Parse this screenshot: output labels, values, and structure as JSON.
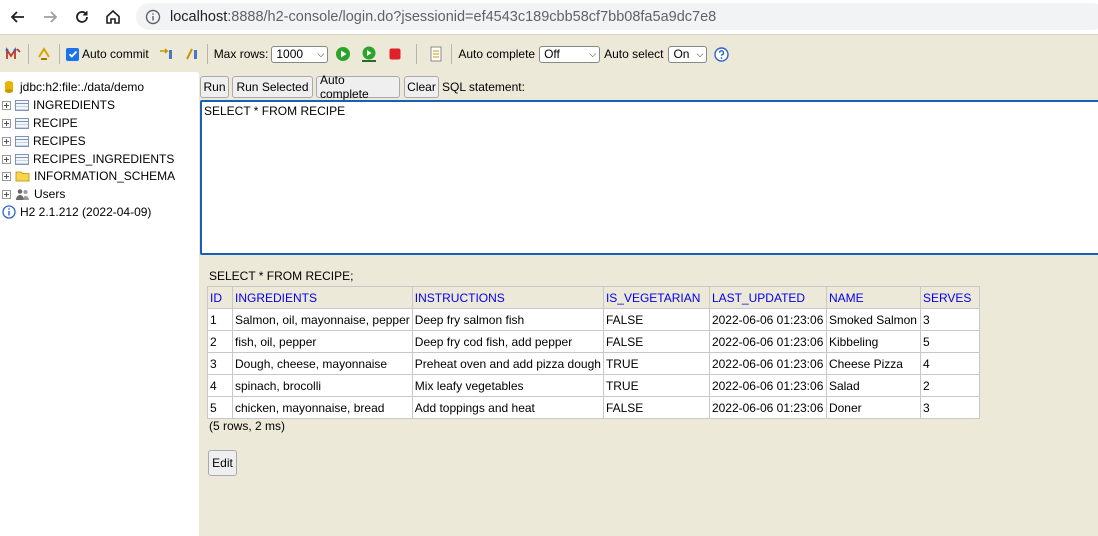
{
  "browser": {
    "url_host": "localhost",
    "url_path": ":8888/h2-console/login.do?jsessionid=ef4543c189cbb58cf7bb08fa5a9dc7e8"
  },
  "toolbar": {
    "auto_commit_label": "Auto commit",
    "max_rows_label": "Max rows:",
    "max_rows_value": "1000",
    "auto_complete_label": "Auto complete",
    "auto_complete_value": "Off",
    "auto_select_label": "Auto select",
    "auto_select_value": "On"
  },
  "tree": {
    "connection": "jdbc:h2:file:./data/demo",
    "tables": [
      "INGREDIENTS",
      "RECIPE",
      "RECIPES",
      "RECIPES_INGREDIENTS"
    ],
    "schema": "INFORMATION_SCHEMA",
    "users": "Users",
    "version": "H2 2.1.212 (2022-04-09)"
  },
  "sql_buttons": {
    "run": "Run",
    "run_selected": "Run Selected",
    "auto_complete": "Auto complete",
    "clear": "Clear",
    "sql_statement_label": "SQL statement:"
  },
  "editor": {
    "text": "SELECT * FROM RECIPE"
  },
  "result": {
    "title": "SELECT * FROM RECIPE;",
    "columns": [
      "ID",
      "INGREDIENTS",
      "INSTRUCTIONS",
      "IS_VEGETARIAN",
      "LAST_UPDATED",
      "NAME",
      "SERVES"
    ],
    "rows": [
      [
        "1",
        "Salmon, oil, mayonnaise, pepper",
        "Deep fry salmon fish",
        "FALSE",
        "2022-06-06 01:23:06",
        "Smoked Salmon",
        "3"
      ],
      [
        "2",
        "fish, oil, pepper",
        "Deep fry cod fish, add pepper",
        "FALSE",
        "2022-06-06 01:23:06",
        "Kibbeling",
        "5"
      ],
      [
        "3",
        "Dough, cheese, mayonnaise",
        "Preheat oven and add pizza dough",
        "TRUE",
        "2022-06-06 01:23:06",
        "Cheese Pizza",
        "4"
      ],
      [
        "4",
        "spinach, brocolli",
        "Mix leafy vegetables",
        "TRUE",
        "2022-06-06 01:23:06",
        "Salad",
        "2"
      ],
      [
        "5",
        "chicken, mayonnaise, bread",
        "Add toppings and heat",
        "FALSE",
        "2022-06-06 01:23:06",
        "Doner",
        "3"
      ]
    ],
    "summary": "(5 rows, 2 ms)",
    "edit_label": "Edit"
  }
}
